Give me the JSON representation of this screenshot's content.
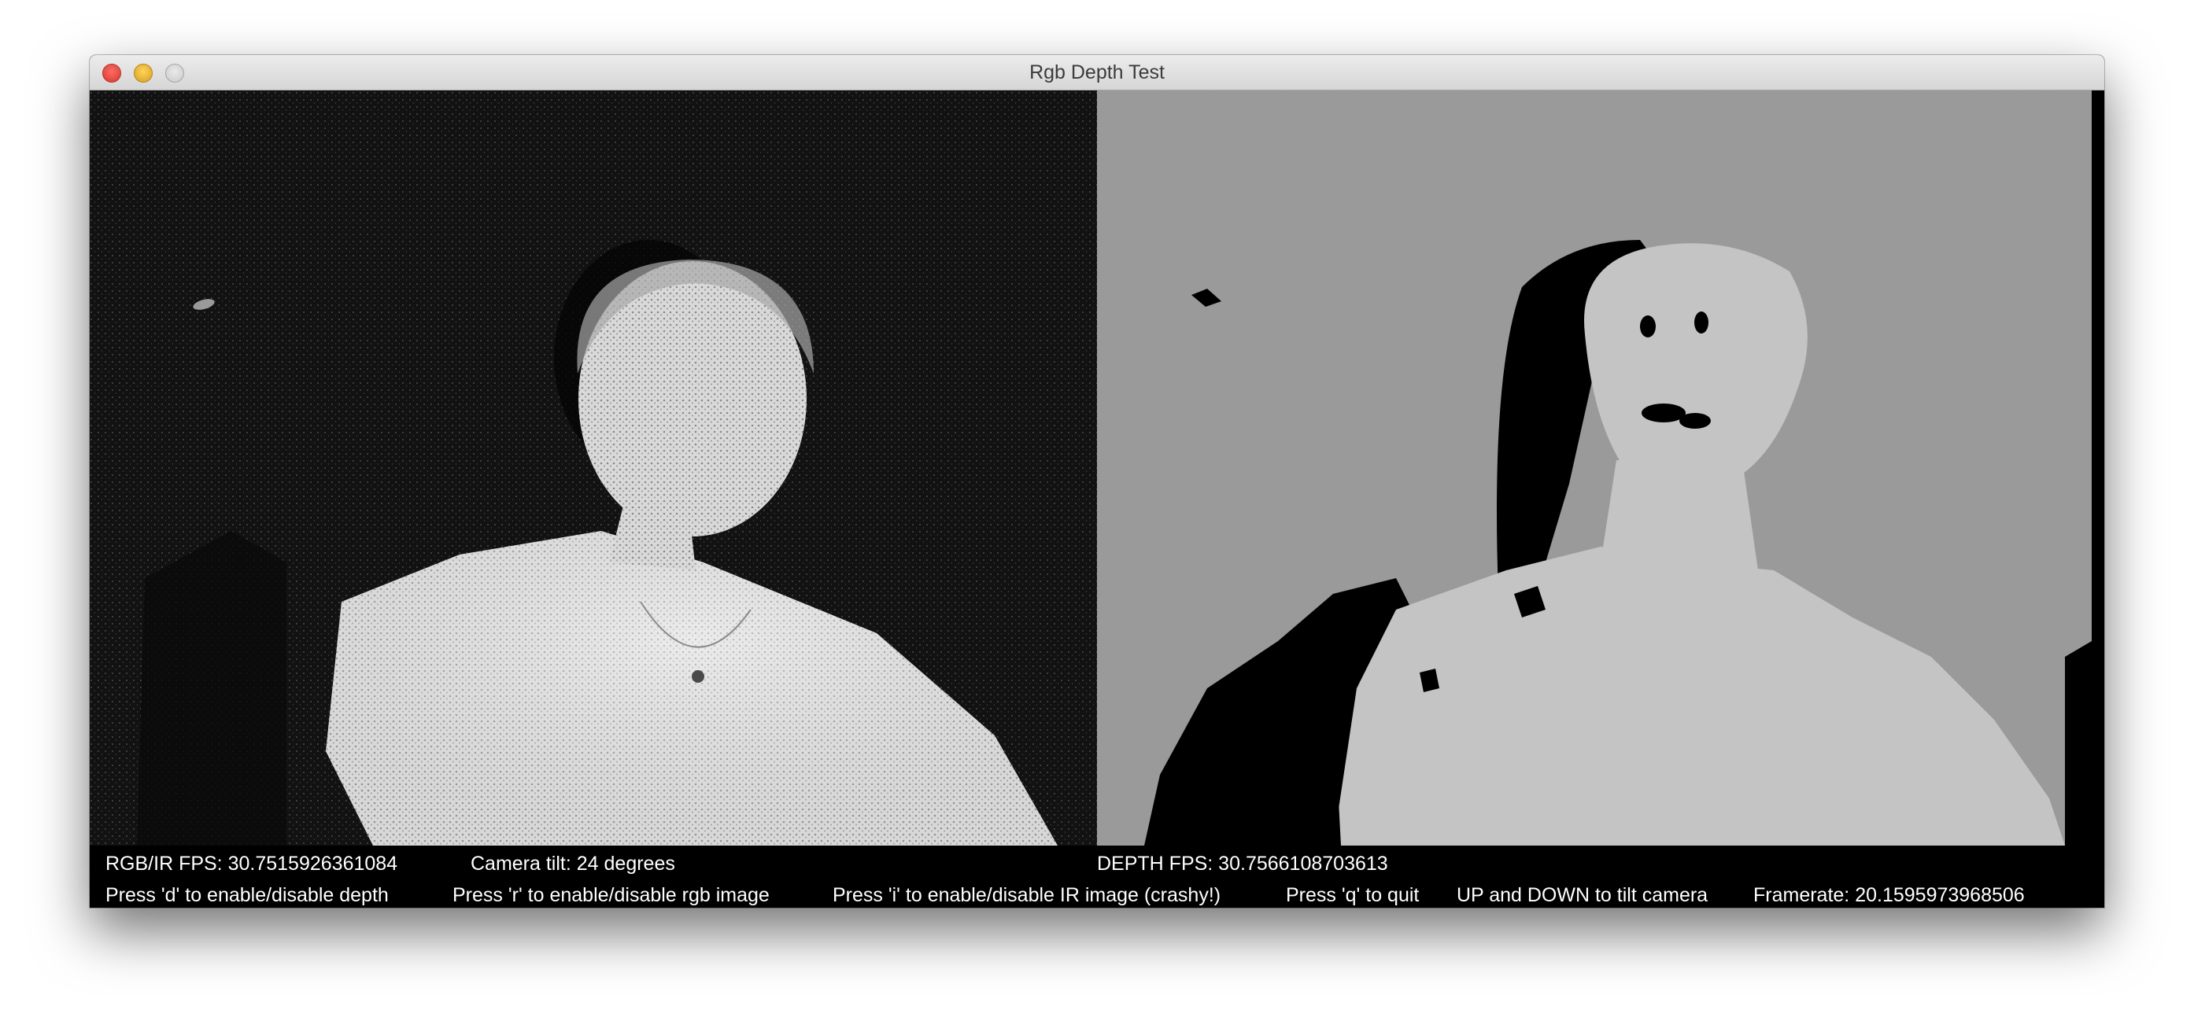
{
  "window": {
    "title": "Rgb Depth Test"
  },
  "panels": {
    "ir_image": "ir-camera-image",
    "depth_image": "depth-map-image"
  },
  "status": {
    "rgb_ir_fps": "RGB/IR FPS: 30.7515926361084",
    "camera_tilt": "Camera tilt: 24 degrees",
    "depth_fps": "DEPTH FPS: 30.7566108703613",
    "help_depth": "Press 'd' to enable/disable depth",
    "help_rgb": "Press 'r' to enable/disable rgb image",
    "help_ir": "Press 'i' to enable/disable IR image (crashy!)",
    "help_quit": "Press 'q' to quit",
    "help_tilt": "UP and DOWN to tilt camera",
    "framerate": "Framerate: 20.1595973968506"
  },
  "colors": {
    "depth_background": "#9a9a9a",
    "depth_person": "#c4c4c4",
    "shadow": "#000000"
  }
}
